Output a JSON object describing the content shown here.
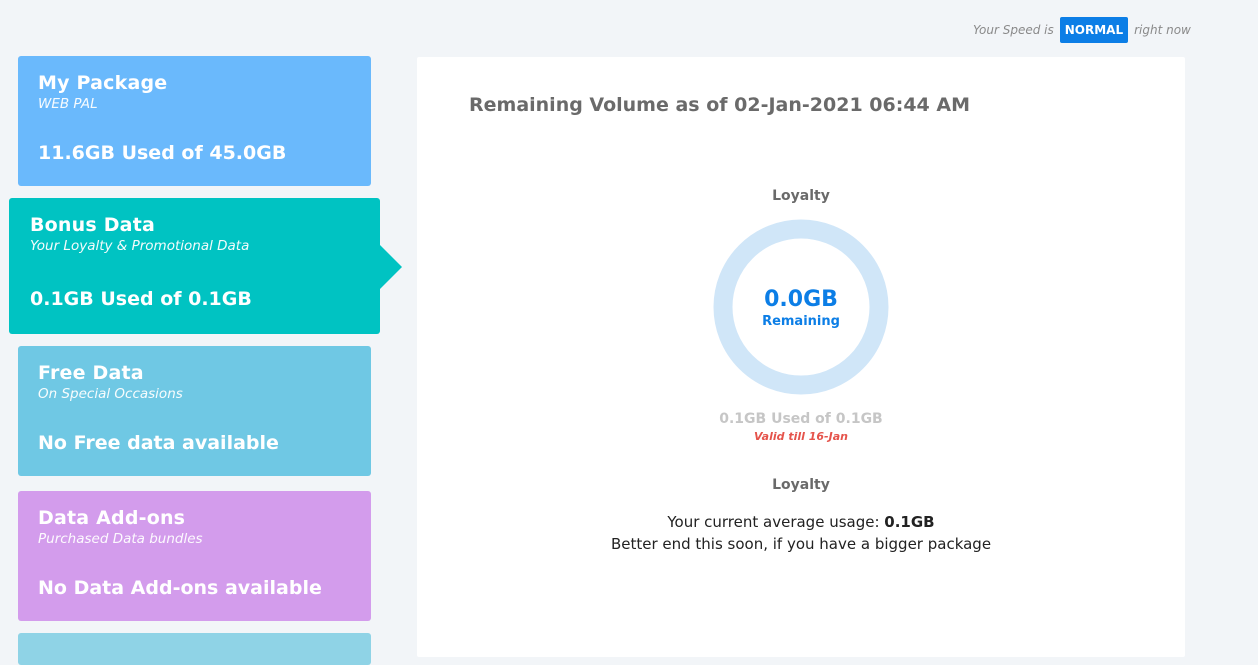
{
  "speed": {
    "prefix": "Your Speed is",
    "status": "NORMAL",
    "suffix": "right now",
    "status_color": "#0c7ee6"
  },
  "cards": {
    "package": {
      "title": "My Package",
      "subtitle": "WEB PAL",
      "usage": "11.6GB Used of 45.0GB",
      "color": "#6ab9fc"
    },
    "bonus": {
      "title": "Bonus Data",
      "subtitle": "Your Loyalty & Promotional Data",
      "usage": "0.1GB Used of 0.1GB",
      "color": "#00c3c2",
      "selected": true
    },
    "free": {
      "title": "Free Data",
      "subtitle": "On Special Occasions",
      "usage": "No Free data available",
      "color": "#6fc8e4"
    },
    "addons": {
      "title": "Data Add-ons",
      "subtitle": "Purchased Data bundles",
      "usage": "No Data Add-ons available",
      "color": "#d39cec"
    }
  },
  "panel": {
    "title": "Remaining Volume as of 02-Jan-2021 06:44 AM",
    "ring_label_top": "Loyalty",
    "ring_value": "0.0GB",
    "ring_sub": "Remaining",
    "ring_remaining_fraction": 0.0,
    "used_text": "0.1GB Used of 0.1GB",
    "valid_text": "Valid till 16-Jan",
    "label_bottom": "Loyalty",
    "avg_prefix": "Your current average usage: ",
    "avg_value": "0.1GB",
    "advice": "Better end this soon, if you have a bigger package"
  }
}
